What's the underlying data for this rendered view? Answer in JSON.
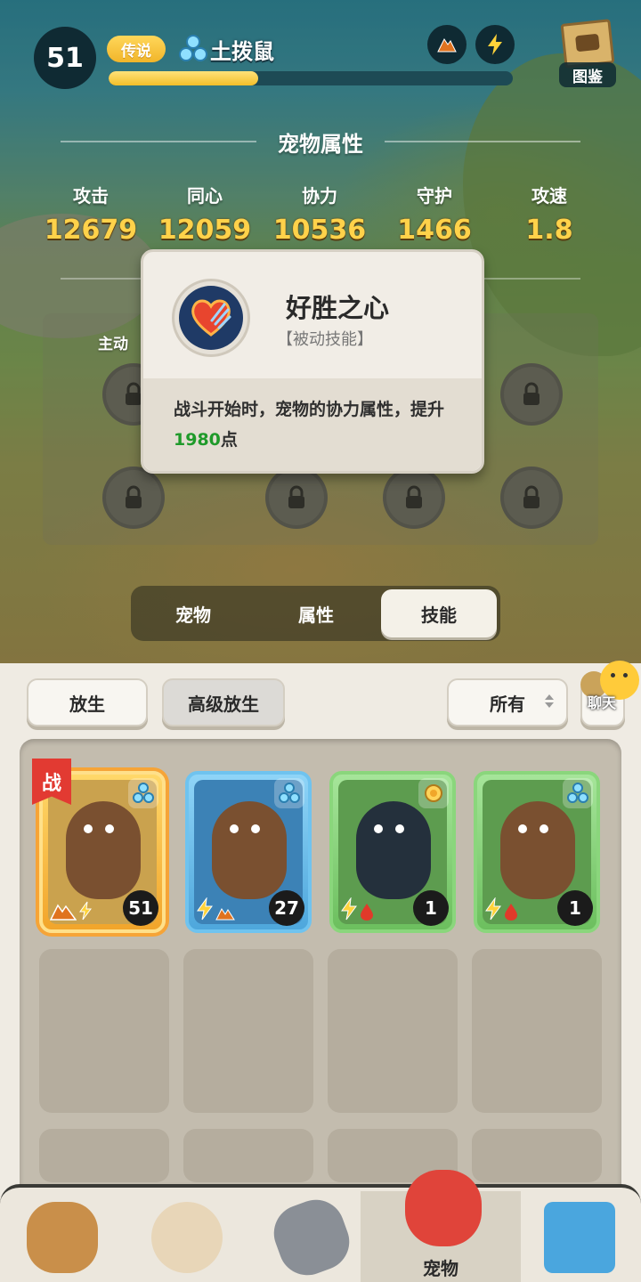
{
  "header": {
    "level": "51",
    "rarity": "传说",
    "pet_name": "土拨鼠",
    "xp_fraction": 0.37,
    "codex_label": "图鉴"
  },
  "attributes": {
    "title": "宠物属性",
    "stats": [
      {
        "label": "攻击",
        "value": "12679"
      },
      {
        "label": "同心",
        "value": "12059"
      },
      {
        "label": "协力",
        "value": "10536"
      },
      {
        "label": "守护",
        "value": "1466"
      },
      {
        "label": "攻速",
        "value": "1.8"
      }
    ]
  },
  "skills": {
    "panel_label": "主动"
  },
  "tooltip": {
    "name": "好胜之心",
    "type": "【被动技能】",
    "desc_before": "战斗开始时，宠物的协力属性，提升",
    "desc_value": "1980",
    "desc_after": "点"
  },
  "tabs": [
    {
      "label": "宠物",
      "active": false
    },
    {
      "label": "属性",
      "active": false
    },
    {
      "label": "技能",
      "active": true
    }
  ],
  "actions": {
    "release": "放生",
    "advanced_release": "高级放生",
    "filter": "所有",
    "chat": "聊天"
  },
  "pets": [
    {
      "level": "51",
      "in_battle": true,
      "battle_label": "战"
    },
    {
      "level": "27",
      "in_battle": false
    },
    {
      "level": "1",
      "in_battle": false
    },
    {
      "level": "1",
      "in_battle": false
    }
  ],
  "nav": {
    "pet_label": "宠物"
  },
  "colors": {
    "accent_gold": "#ffd24a",
    "highlight_green": "#1f9a2a",
    "battle_red": "#e23a32"
  }
}
